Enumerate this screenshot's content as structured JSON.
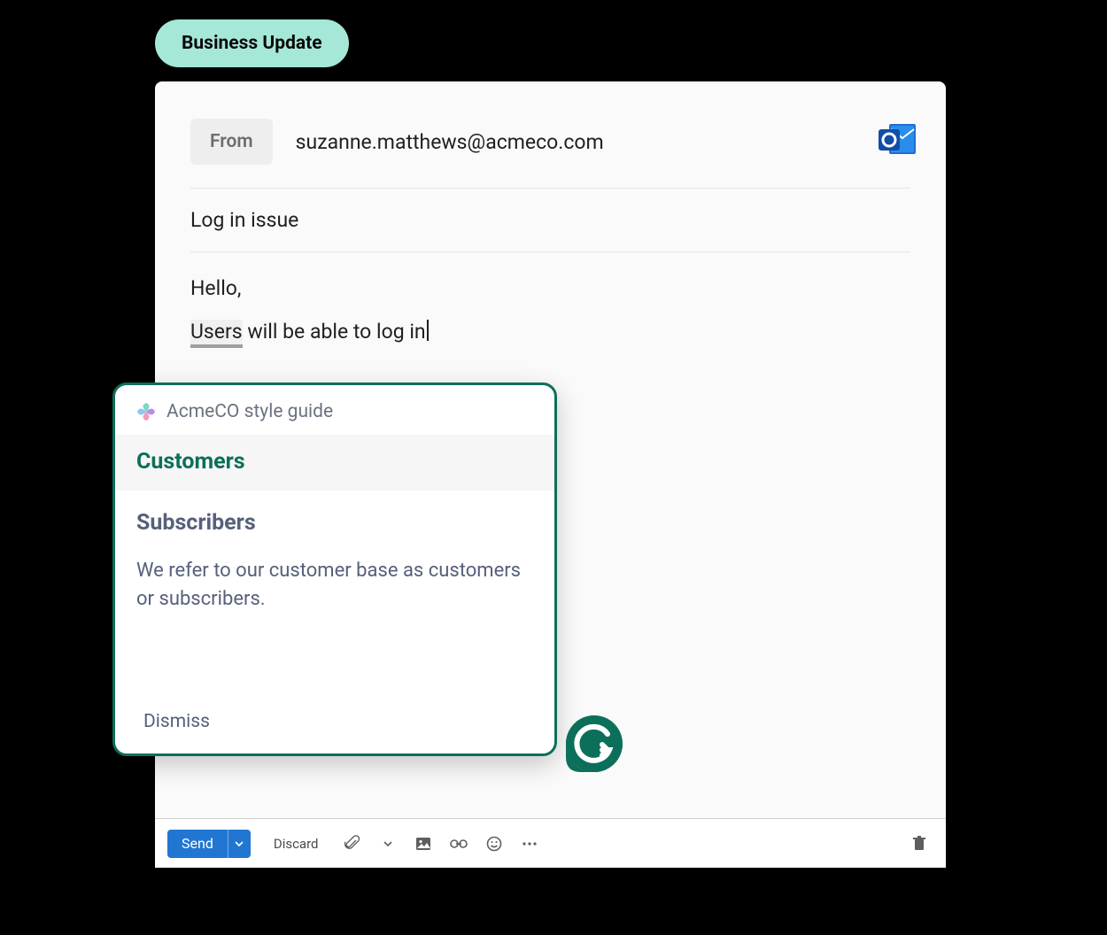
{
  "badge": {
    "text": "Business Update"
  },
  "from": {
    "label": "From",
    "email": "suzanne.matthews@acmeco.com"
  },
  "subject": "Log in issue",
  "body": {
    "greeting": "Hello,",
    "flagged": "Users",
    "rest": " will be able to log in"
  },
  "popup": {
    "source": "AcmeCO style guide",
    "option_primary": "Customers",
    "option_secondary": "Subscribers",
    "explanation": "We refer to our customer base as customers or subscribers.",
    "dismiss": "Dismiss"
  },
  "toolbar": {
    "send": "Send",
    "discard": "Discard"
  }
}
